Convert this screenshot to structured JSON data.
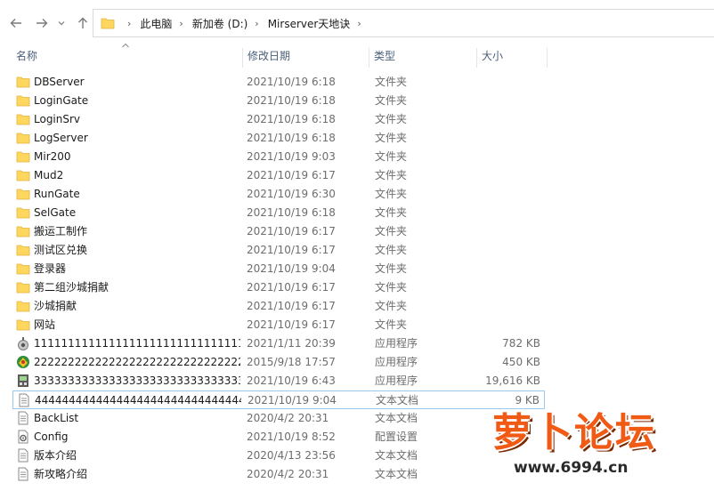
{
  "breadcrumb": [
    "此电脑",
    "新加卷 (D:)",
    "Mirserver天地诀"
  ],
  "columns": {
    "name": "名称",
    "date": "修改日期",
    "type": "类型",
    "size": "大小"
  },
  "rows": [
    {
      "name": "DBServer",
      "date": "2021/10/19 6:18",
      "type": "文件夹",
      "size": "",
      "icon": "folder-icon"
    },
    {
      "name": "LoginGate",
      "date": "2021/10/19 6:18",
      "type": "文件夹",
      "size": "",
      "icon": "folder-icon"
    },
    {
      "name": "LoginSrv",
      "date": "2021/10/19 6:18",
      "type": "文件夹",
      "size": "",
      "icon": "folder-icon"
    },
    {
      "name": "LogServer",
      "date": "2021/10/19 6:18",
      "type": "文件夹",
      "size": "",
      "icon": "folder-icon"
    },
    {
      "name": "Mir200",
      "date": "2021/10/19 9:03",
      "type": "文件夹",
      "size": "",
      "icon": "folder-icon"
    },
    {
      "name": "Mud2",
      "date": "2021/10/19 6:17",
      "type": "文件夹",
      "size": "",
      "icon": "folder-icon"
    },
    {
      "name": "RunGate",
      "date": "2021/10/19 6:30",
      "type": "文件夹",
      "size": "",
      "icon": "folder-icon"
    },
    {
      "name": "SelGate",
      "date": "2021/10/19 6:18",
      "type": "文件夹",
      "size": "",
      "icon": "folder-icon"
    },
    {
      "name": "搬运工制作",
      "date": "2021/10/19 6:17",
      "type": "文件夹",
      "size": "",
      "icon": "folder-icon"
    },
    {
      "name": "测试区兑换",
      "date": "2021/10/19 6:17",
      "type": "文件夹",
      "size": "",
      "icon": "folder-icon"
    },
    {
      "name": "登录器",
      "date": "2021/10/19 9:04",
      "type": "文件夹",
      "size": "",
      "icon": "folder-icon"
    },
    {
      "name": "第二组沙城捐献",
      "date": "2021/10/19 6:17",
      "type": "文件夹",
      "size": "",
      "icon": "folder-icon"
    },
    {
      "name": "沙城捐献",
      "date": "2021/10/19 6:17",
      "type": "文件夹",
      "size": "",
      "icon": "folder-icon"
    },
    {
      "name": "网站",
      "date": "2021/10/19 6:17",
      "type": "文件夹",
      "size": "",
      "icon": "folder-icon"
    },
    {
      "name": "1111111111111111111111111111111...",
      "date": "2021/1/11 20:39",
      "type": "应用程序",
      "size": "782 KB",
      "icon": "app-icon-1"
    },
    {
      "name": "2222222222222222222222222222222...",
      "date": "2015/9/18 17:57",
      "type": "应用程序",
      "size": "450 KB",
      "icon": "app-icon-2"
    },
    {
      "name": "3333333333333333333333333333333...",
      "date": "2021/10/19 6:43",
      "type": "应用程序",
      "size": "19,616 KB",
      "icon": "app-icon-3"
    },
    {
      "name": "4444444444444444444444444444444...",
      "date": "2021/10/19 9:04",
      "type": "文本文档",
      "size": "9 KB",
      "icon": "text-file-icon"
    },
    {
      "name": "BackList",
      "date": "2020/4/2 20:31",
      "type": "文本文档",
      "size": "",
      "icon": "text-file-icon"
    },
    {
      "name": "Config",
      "date": "2021/10/19 8:52",
      "type": "配置设置",
      "size": "",
      "icon": "config-file-icon"
    },
    {
      "name": "版本介绍",
      "date": "2020/4/13 23:56",
      "type": "文本文档",
      "size": "",
      "icon": "text-file-icon"
    },
    {
      "name": "新攻略介绍",
      "date": "2020/4/2 20:31",
      "type": "文本文档",
      "size": "",
      "icon": "text-file-icon"
    }
  ],
  "selected_row": 17,
  "watermark": {
    "text": "萝卜论坛",
    "url": "www.6994.cn"
  },
  "colors": {
    "folder": "#ffd75e",
    "selection_border": "#99c9ef",
    "header_text": "#4c607a",
    "watermark": "#f05a14"
  }
}
